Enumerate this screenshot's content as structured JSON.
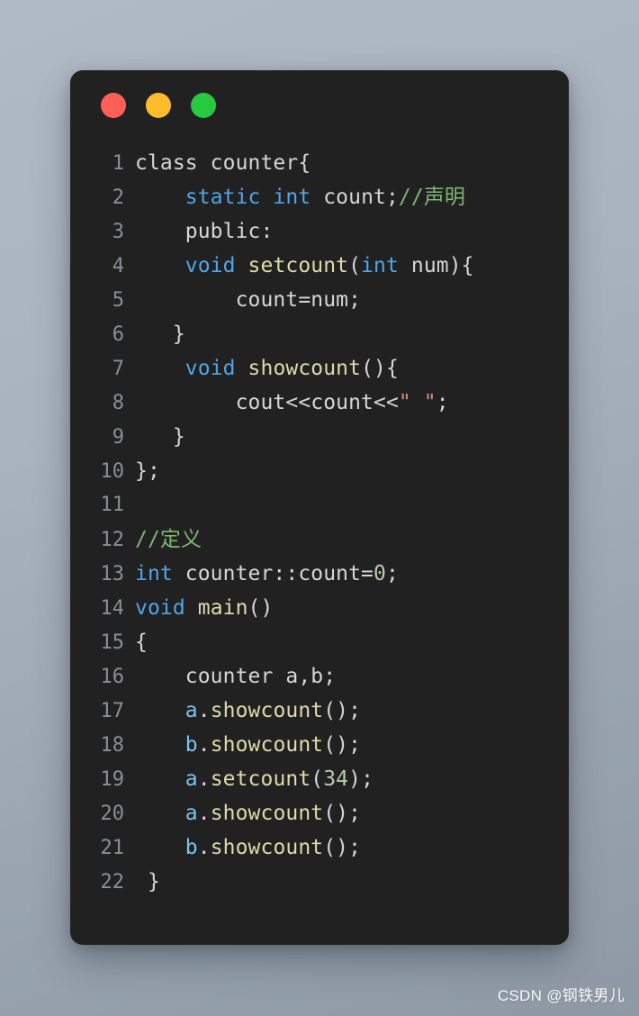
{
  "window": {
    "dots": [
      {
        "name": "close",
        "color": "#ff5f56"
      },
      {
        "name": "minimize",
        "color": "#ffbd2e"
      },
      {
        "name": "maximize",
        "color": "#27c93f"
      }
    ]
  },
  "editor": {
    "language": "C++",
    "theme_background": "#212121",
    "line_number_color": "#8b8f93",
    "token_colors": {
      "plain": "#d6d6d6",
      "keyword": "#4fa6e8",
      "function": "#dcdcaa",
      "comment": "#7fb573",
      "string": "#ce9178",
      "number": "#b5cea8",
      "variable": "#7cc2f0"
    },
    "lines": [
      {
        "n": "1",
        "tokens": [
          {
            "t": "class counter{",
            "c": "plain"
          }
        ]
      },
      {
        "n": "2",
        "tokens": [
          {
            "t": "    ",
            "c": "plain"
          },
          {
            "t": "static",
            "c": "keyword"
          },
          {
            "t": " ",
            "c": "plain"
          },
          {
            "t": "int",
            "c": "keyword"
          },
          {
            "t": " count;",
            "c": "plain"
          },
          {
            "t": "//声明",
            "c": "comment"
          }
        ]
      },
      {
        "n": "3",
        "tokens": [
          {
            "t": "    public:",
            "c": "plain"
          }
        ]
      },
      {
        "n": "4",
        "tokens": [
          {
            "t": "    ",
            "c": "plain"
          },
          {
            "t": "void",
            "c": "keyword"
          },
          {
            "t": " ",
            "c": "plain"
          },
          {
            "t": "setcount",
            "c": "function"
          },
          {
            "t": "(",
            "c": "plain"
          },
          {
            "t": "int",
            "c": "keyword"
          },
          {
            "t": " num){",
            "c": "plain"
          }
        ]
      },
      {
        "n": "5",
        "tokens": [
          {
            "t": "        count=num;",
            "c": "plain"
          }
        ]
      },
      {
        "n": "6",
        "tokens": [
          {
            "t": "   }",
            "c": "plain"
          }
        ]
      },
      {
        "n": "7",
        "tokens": [
          {
            "t": "    ",
            "c": "plain"
          },
          {
            "t": "void",
            "c": "keyword"
          },
          {
            "t": " ",
            "c": "plain"
          },
          {
            "t": "showcount",
            "c": "function"
          },
          {
            "t": "(){",
            "c": "plain"
          }
        ]
      },
      {
        "n": "8",
        "tokens": [
          {
            "t": "        cout<<count<<",
            "c": "plain"
          },
          {
            "t": "\" \"",
            "c": "string"
          },
          {
            "t": ";",
            "c": "plain"
          }
        ]
      },
      {
        "n": "9",
        "tokens": [
          {
            "t": "   }",
            "c": "plain"
          }
        ]
      },
      {
        "n": "10",
        "tokens": [
          {
            "t": "};",
            "c": "plain"
          }
        ]
      },
      {
        "n": "11",
        "tokens": [
          {
            "t": "",
            "c": "plain"
          }
        ]
      },
      {
        "n": "12",
        "tokens": [
          {
            "t": "//定义",
            "c": "comment"
          }
        ]
      },
      {
        "n": "13",
        "tokens": [
          {
            "t": "int",
            "c": "keyword"
          },
          {
            "t": " counter::count=",
            "c": "plain"
          },
          {
            "t": "0",
            "c": "number"
          },
          {
            "t": ";",
            "c": "plain"
          }
        ]
      },
      {
        "n": "14",
        "tokens": [
          {
            "t": "void",
            "c": "keyword"
          },
          {
            "t": " ",
            "c": "plain"
          },
          {
            "t": "main",
            "c": "function"
          },
          {
            "t": "()",
            "c": "plain"
          }
        ]
      },
      {
        "n": "15",
        "tokens": [
          {
            "t": "{",
            "c": "plain"
          }
        ]
      },
      {
        "n": "16",
        "tokens": [
          {
            "t": "    counter a,b;",
            "c": "plain"
          }
        ]
      },
      {
        "n": "17",
        "tokens": [
          {
            "t": "    ",
            "c": "plain"
          },
          {
            "t": "a",
            "c": "variable"
          },
          {
            "t": ".",
            "c": "plain"
          },
          {
            "t": "showcount",
            "c": "function"
          },
          {
            "t": "();",
            "c": "plain"
          }
        ]
      },
      {
        "n": "18",
        "tokens": [
          {
            "t": "    ",
            "c": "plain"
          },
          {
            "t": "b",
            "c": "variable"
          },
          {
            "t": ".",
            "c": "plain"
          },
          {
            "t": "showcount",
            "c": "function"
          },
          {
            "t": "();",
            "c": "plain"
          }
        ]
      },
      {
        "n": "19",
        "tokens": [
          {
            "t": "    ",
            "c": "plain"
          },
          {
            "t": "a",
            "c": "variable"
          },
          {
            "t": ".",
            "c": "plain"
          },
          {
            "t": "setcount",
            "c": "function"
          },
          {
            "t": "(",
            "c": "plain"
          },
          {
            "t": "34",
            "c": "number"
          },
          {
            "t": ");",
            "c": "plain"
          }
        ]
      },
      {
        "n": "20",
        "tokens": [
          {
            "t": "    ",
            "c": "plain"
          },
          {
            "t": "a",
            "c": "variable"
          },
          {
            "t": ".",
            "c": "plain"
          },
          {
            "t": "showcount",
            "c": "function"
          },
          {
            "t": "();",
            "c": "plain"
          }
        ]
      },
      {
        "n": "21",
        "tokens": [
          {
            "t": "    ",
            "c": "plain"
          },
          {
            "t": "b",
            "c": "variable"
          },
          {
            "t": ".",
            "c": "plain"
          },
          {
            "t": "showcount",
            "c": "function"
          },
          {
            "t": "();",
            "c": "plain"
          }
        ]
      },
      {
        "n": "22",
        "tokens": [
          {
            "t": " }",
            "c": "plain"
          }
        ]
      }
    ]
  },
  "watermark": {
    "text": "CSDN @钢铁男儿"
  }
}
